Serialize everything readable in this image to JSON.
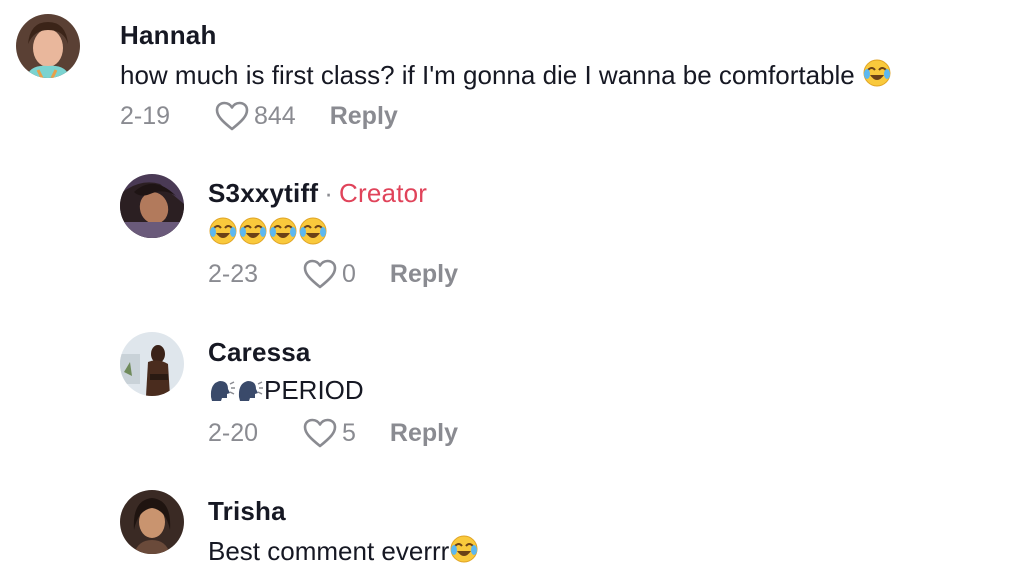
{
  "comments": [
    {
      "username": "Hannah",
      "text": "how much is first class? if I'm gonna die I wanna be comfortable",
      "text_emoji": "face-with-tears-of-joy",
      "date": "2-19",
      "likes": "844",
      "reply_label": "Reply",
      "avatar_icon": "avatar-hannah"
    },
    {
      "username": "S3xxytiff",
      "creator_separator": "·",
      "creator_label": "Creator",
      "text": "",
      "text_emojis": [
        "face-with-tears-of-joy",
        "face-with-tears-of-joy",
        "face-with-tears-of-joy",
        "face-with-tears-of-joy"
      ],
      "date": "2-23",
      "likes": "0",
      "reply_label": "Reply",
      "avatar_icon": "avatar-s3xxytiff"
    },
    {
      "username": "Caressa",
      "text": "PERIOD",
      "text_emojis_prefix": [
        "speaking-head",
        "speaking-head"
      ],
      "date": "2-20",
      "likes": "5",
      "reply_label": "Reply",
      "avatar_icon": "avatar-caressa"
    },
    {
      "username": "Trisha",
      "text": "Best comment everrr",
      "text_emoji": "face-with-tears-of-joy",
      "avatar_icon": "avatar-trisha"
    }
  ],
  "colors": {
    "text": "#161823",
    "secondary": "#8a8b91",
    "creator": "#e0435a"
  }
}
